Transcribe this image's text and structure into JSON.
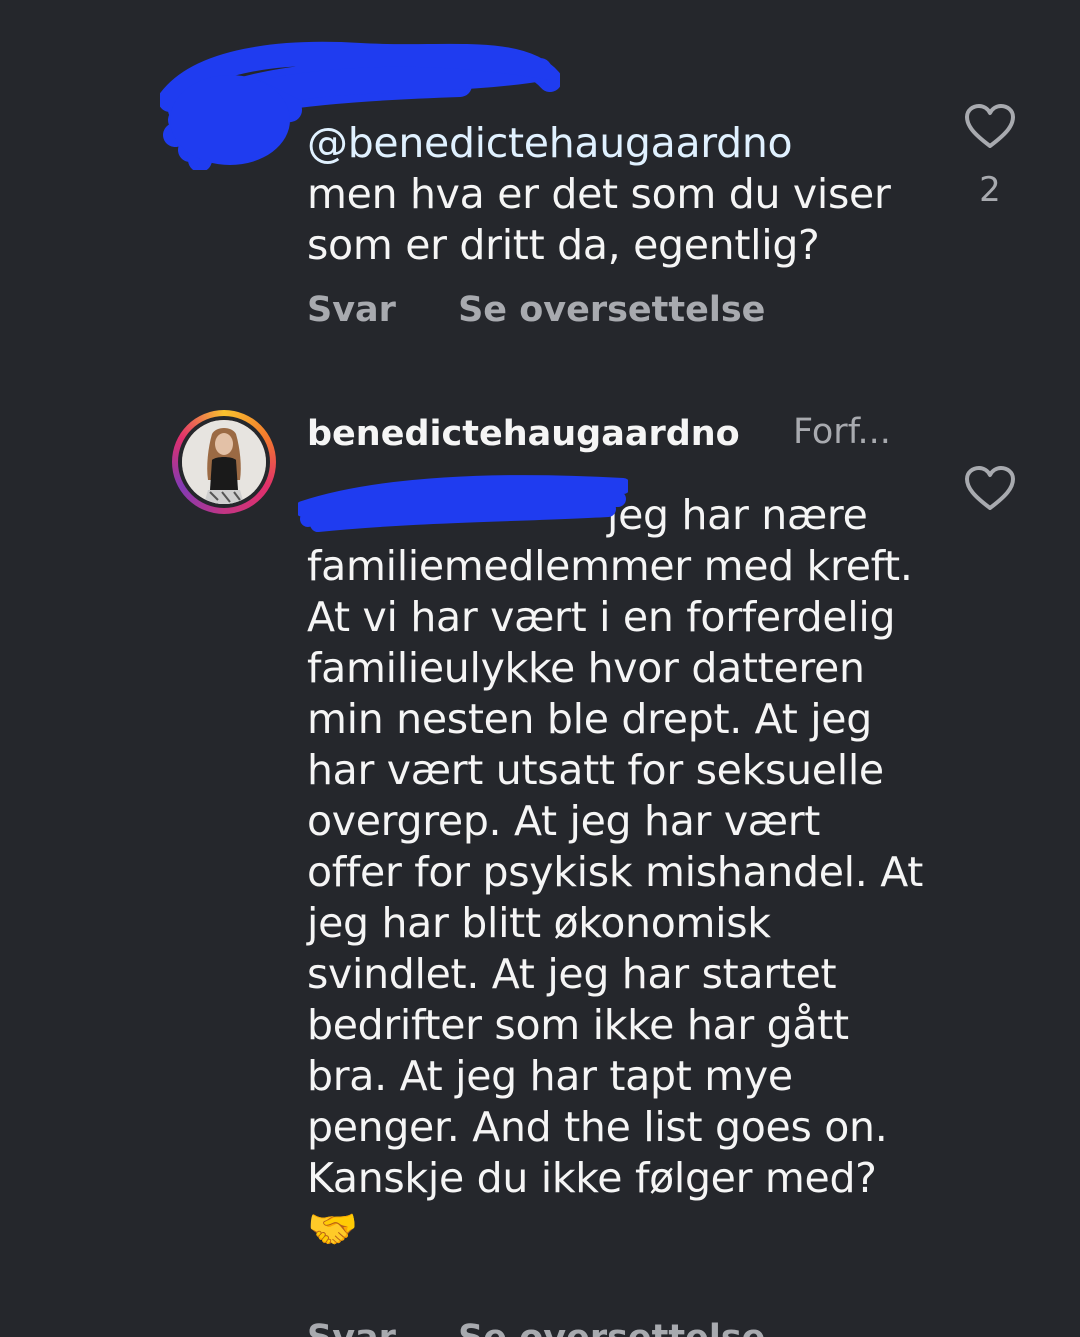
{
  "comment1": {
    "mention": "@benedictehaugaardno",
    "text": "men hva er det som du viser som er dritt da, egentlig?",
    "like_count": "2",
    "reply_label": "Svar",
    "translate_label": "Se oversettelse"
  },
  "comment2": {
    "username": "benedictehaugaardno",
    "author_tag": "Forf...",
    "text": "jeg har nære familiemedlemmer med kreft. At vi har vært i en forferdelig familieulykke hvor datteren min nesten ble drept. At jeg har vært utsatt for seksuelle overgrep. At jeg har vært offer for psykisk mishandel. At jeg har blitt økonomisk svindlet. At jeg har startet bedrifter som ikke har gått bra. At jeg har tapt mye penger. And the list goes on. Kanskje du ikke følger med? 🤝",
    "reply_label": "Svar",
    "translate_label": "Se oversettelse"
  },
  "colors": {
    "background": "#25272c",
    "text": "#f5f5f5",
    "muted": "#a8aaaf",
    "redaction": "#1f3cf0"
  },
  "icons": {
    "like": "heart-outline-icon"
  }
}
